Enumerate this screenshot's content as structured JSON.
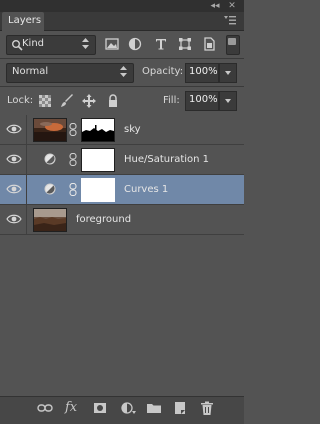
{
  "panel": {
    "tab_label": "Layers",
    "collapse_glyph": "◂◂",
    "close_glyph": "✕"
  },
  "filter": {
    "kind_label": "Kind",
    "icons": [
      "pixel-filter-icon",
      "adjustment-filter-icon",
      "type-filter-icon",
      "shape-filter-icon",
      "smart-object-filter-icon"
    ]
  },
  "blend": {
    "mode": "Normal",
    "opacity_label": "Opacity:",
    "opacity_value": "100%"
  },
  "lock": {
    "label": "Lock:",
    "icons": [
      "lock-transparent-icon",
      "lock-image-icon",
      "lock-position-icon",
      "lock-all-icon"
    ],
    "fill_label": "Fill:",
    "fill_value": "100%"
  },
  "layers": [
    {
      "name": "sky",
      "type": "pixel-with-mask",
      "visible": true,
      "selected": false
    },
    {
      "name": "Hue/Saturation 1",
      "type": "adjustment",
      "visible": true,
      "selected": false
    },
    {
      "name": "Curves 1",
      "type": "adjustment",
      "visible": true,
      "selected": true
    },
    {
      "name": "foreground",
      "type": "pixel",
      "visible": true,
      "selected": false
    }
  ],
  "bottom_bar": {
    "icons": [
      "link-layers-icon",
      "fx-icon",
      "add-mask-icon",
      "new-adjustment-icon",
      "new-group-icon",
      "new-layer-icon",
      "delete-layer-icon"
    ],
    "fx_label": "fx"
  },
  "colors": {
    "panel_bg": "#535353",
    "selected_row": "#7088a8",
    "field_bg": "#3b3b3b"
  }
}
